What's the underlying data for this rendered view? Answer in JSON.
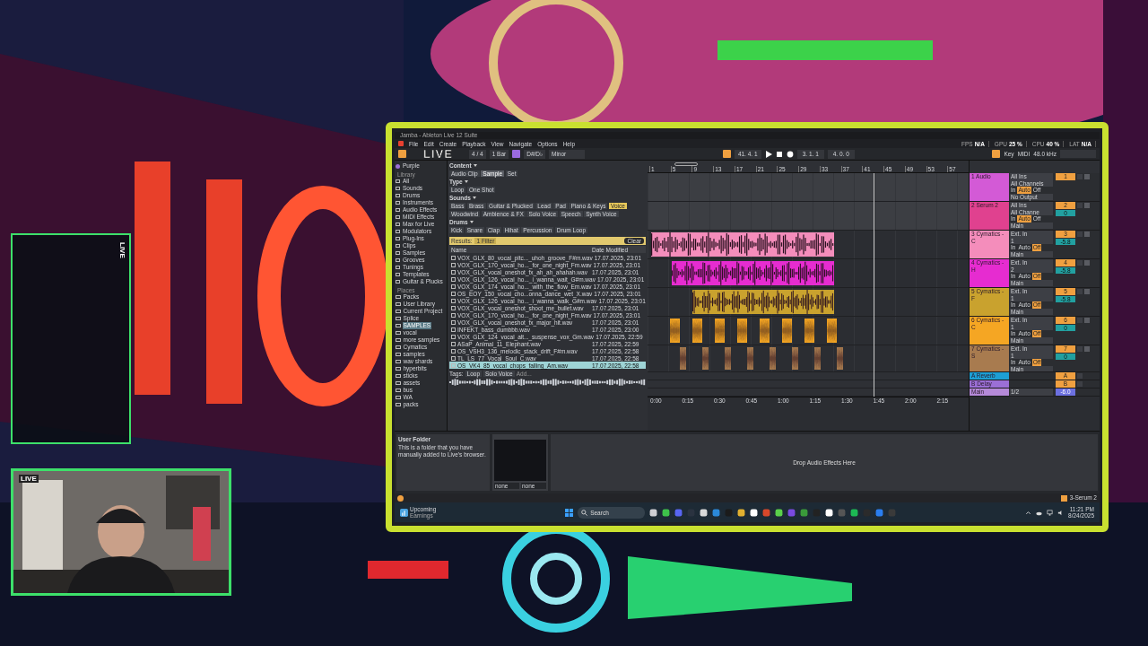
{
  "overlay": {
    "live_badge": "LIVE",
    "side_panel_label": "LIVE",
    "camera_label": "LIVE"
  },
  "daw": {
    "title": "Jamba - Ableton Live 12 Suite",
    "menu": [
      "File",
      "Edit",
      "Create",
      "Playback",
      "View",
      "Navigate",
      "Options",
      "Help"
    ],
    "perf": [
      {
        "label": "FPS",
        "value": "N/A"
      },
      {
        "label": "GPU",
        "value": "25 %"
      },
      {
        "label": "CPU",
        "value": "40 %"
      },
      {
        "label": "LAT",
        "value": "N/A"
      }
    ],
    "control_bar": {
      "meter": "4 / 4",
      "quantize": "1 Bar",
      "scale_root": "D#/D♭",
      "scale": "Minor",
      "position": "41. 4. 1",
      "loop_start": "3. 1. 1",
      "loop_length": "4. 0. 0",
      "key_label": "Key",
      "midi_label": "MIDI",
      "sample_rate": "48.0 kHz"
    },
    "browser": {
      "collections": [
        {
          "label": "Purple",
          "color": "#9b6fd6"
        }
      ],
      "library_heading": "Library",
      "library": [
        "All",
        "Sounds",
        "Drums",
        "Instruments",
        "Audio Effects",
        "MIDI Effects",
        "Max for Live",
        "Modulators",
        "Plug-Ins",
        "Clips",
        "Samples",
        "Grooves",
        "Tunings",
        "Templates",
        "Guitar & Plucks"
      ],
      "places_heading": "Places",
      "places": [
        {
          "label": "Packs",
          "selected": false
        },
        {
          "label": "User Library",
          "selected": false
        },
        {
          "label": "Current Project",
          "selected": false
        },
        {
          "label": "Splice",
          "selected": false
        },
        {
          "label": "SAMPLES",
          "selected": true
        },
        {
          "label": "vocal",
          "selected": false
        },
        {
          "label": "more samples",
          "selected": false
        },
        {
          "label": "Cymatics",
          "selected": false
        },
        {
          "label": "samples",
          "selected": false
        },
        {
          "label": "wav shards",
          "selected": false
        },
        {
          "label": "hyperbits",
          "selected": false
        },
        {
          "label": "sticks",
          "selected": false
        },
        {
          "label": "assets",
          "selected": false
        },
        {
          "label": "bus",
          "selected": false
        },
        {
          "label": "WA",
          "selected": false
        },
        {
          "label": "packs",
          "selected": false
        }
      ],
      "filters": [
        {
          "heading": "Content",
          "chips": [
            {
              "label": "Audio Clip",
              "selected": false
            },
            {
              "label": "Sample",
              "selected": true
            },
            {
              "label": "Set",
              "selected": false
            }
          ]
        },
        {
          "heading": "Type",
          "chips": [
            {
              "label": "Loop",
              "selected": false
            },
            {
              "label": "One Shot",
              "selected": false
            }
          ]
        },
        {
          "heading": "Sounds",
          "chips": [
            {
              "label": "Bass",
              "selected": false
            },
            {
              "label": "Brass",
              "selected": false
            },
            {
              "label": "Guitar & Plucked",
              "selected": false
            },
            {
              "label": "Lead",
              "selected": false
            },
            {
              "label": "Pad",
              "selected": false
            },
            {
              "label": "Piano & Keys",
              "selected": false
            },
            {
              "label": "Voice",
              "selected": true
            },
            {
              "label": "Woodwind",
              "selected": false
            },
            {
              "label": "Ambience & FX",
              "selected": false
            },
            {
              "label": "Solo Voice",
              "selected": false
            },
            {
              "label": "Speech",
              "selected": false
            },
            {
              "label": "Synth Voice",
              "selected": false
            }
          ]
        },
        {
          "heading": "Drums",
          "chips": [
            {
              "label": "Kick",
              "selected": false
            },
            {
              "label": "Snare",
              "selected": false
            },
            {
              "label": "Clap",
              "selected": false
            },
            {
              "label": "Hihat",
              "selected": false
            },
            {
              "label": "Percussion",
              "selected": false
            },
            {
              "label": "Drum Loop",
              "selected": false
            }
          ]
        }
      ],
      "results_label": "Results:",
      "filter_count": "1 Filter",
      "clear": "Clear",
      "columns": [
        "Name",
        "Date Modified"
      ],
      "files": [
        {
          "name": "VOX_GLX_80_vocal_pitc..._uhoh_groove_F#m.wav",
          "date": "17.07.2025, 23:01",
          "selected": false
        },
        {
          "name": "VOX_GLX_170_vocal_ho..._for_one_night_Fm.wav",
          "date": "17.07.2025, 23:01",
          "selected": false
        },
        {
          "name": "VOX_GLX_vocal_oneshot_fx_ah_ah_ahahah.wav",
          "date": "17.07.2025, 23:01",
          "selected": false
        },
        {
          "name": "VOX_GLX_126_vocal_ho..._i_wanna_wait_G#m.wav",
          "date": "17.07.2025, 23:01",
          "selected": false
        },
        {
          "name": "VOX_GLX_174_vocal_ho..._with_the_flow_Em.wav",
          "date": "17.07.2025, 23:01",
          "selected": false
        },
        {
          "name": "OS_EOY_150_vocal_cho...onna_dance_wet_X.wav",
          "date": "17.07.2025, 23:01",
          "selected": false
        },
        {
          "name": "VOX_GLX_126_vocal_ho..._i_wanna_walk_G#m.wav",
          "date": "17.07.2025, 23:01",
          "selected": false
        },
        {
          "name": "VOX_GLX_vocal_oneshot_shoot_me_bullet.wav",
          "date": "17.07.2025, 23:01",
          "selected": false
        },
        {
          "name": "VOX_GLX_170_vocal_ho..._for_one_night_Fm.wav",
          "date": "17.07.2025, 23:01",
          "selected": false
        },
        {
          "name": "VOX_GLX_vocal_oneshot_fx_major_hit.wav",
          "date": "17.07.2025, 23:01",
          "selected": false
        },
        {
          "name": "INFEKT_bass_dumbbb.wav",
          "date": "17.07.2025, 23:00",
          "selected": false
        },
        {
          "name": "VOX_GLX_124_vocal_alt..._suspense_vox_Gm.wav",
          "date": "17.07.2025, 22:59",
          "selected": false
        },
        {
          "name": "ASaP_Animal_11_Elephant.wav",
          "date": "17.07.2025, 22:59",
          "selected": false
        },
        {
          "name": "OS_VSH3_136_melodic_stack_drift_F#m.wav",
          "date": "17.07.2025, 22:58",
          "selected": false
        },
        {
          "name": "TL_LS_77_Vocal_Soul_C.wav",
          "date": "17.07.2025, 22:58",
          "selected": false
        },
        {
          "name": "OS_VK4_85_vocal_chops_falling_Am.wav",
          "date": "17.07.2025, 22:58",
          "selected": true
        }
      ],
      "tags_label": "Tags:",
      "tags": [
        "Loop",
        "Solo Voice"
      ],
      "add_tag": "Add..."
    },
    "ruler": [
      "1",
      "5",
      "9",
      "13",
      "17",
      "21",
      "25",
      "29",
      "33",
      "37",
      "41",
      "45",
      "49",
      "53",
      "57"
    ],
    "time_ruler": [
      "0:00",
      "0:15",
      "0:30",
      "0:45",
      "1:00",
      "1:15",
      "1:30",
      "1:45",
      "2:00",
      "2:15"
    ],
    "tracks": [
      {
        "kind": "audio",
        "name": "1 Audio",
        "color": "#d35ad6",
        "input": "All Ins",
        "channel": "All Channels",
        "output": "No Output",
        "number": "1",
        "monitor": [
          {
            "label": "In",
            "selected": false
          },
          {
            "label": "Auto",
            "selected": true
          },
          {
            "label": "Off",
            "selected": false
          }
        ]
      },
      {
        "kind": "midi",
        "name": "2 Serum 2",
        "color": "#e0418f",
        "input": "All Ins",
        "channel": "All Channe",
        "output": "Main",
        "number": "2",
        "volume": "0",
        "monitor": [
          {
            "label": "In",
            "selected": false
          },
          {
            "label": "Auto",
            "selected": true
          },
          {
            "label": "Off",
            "selected": false
          }
        ]
      },
      {
        "kind": "audio",
        "name": "3 Cymatics - C",
        "color": "#f48dbb",
        "input": "Ext. In",
        "channel": "1",
        "output": "Main",
        "number": "3",
        "volume": "-5.8",
        "monitor": [
          {
            "label": "In",
            "selected": false
          },
          {
            "label": "Auto",
            "selected": false
          },
          {
            "label": "Off",
            "selected": true
          }
        ]
      },
      {
        "kind": "audio",
        "name": "4 Cymatics - H",
        "color": "#e62cd0",
        "input": "Ext. In",
        "channel": "2",
        "output": "Main",
        "number": "4",
        "volume": "-5.8",
        "monitor": [
          {
            "label": "In",
            "selected": false
          },
          {
            "label": "Auto",
            "selected": false
          },
          {
            "label": "Off",
            "selected": true
          }
        ]
      },
      {
        "kind": "audio",
        "name": "5 Cymatics - F",
        "color": "#c9a22e",
        "input": "Ext. In",
        "channel": "1",
        "output": "Main",
        "number": "5",
        "volume": "-5.8",
        "monitor": [
          {
            "label": "In",
            "selected": false
          },
          {
            "label": "Auto",
            "selected": false
          },
          {
            "label": "Off",
            "selected": true
          }
        ]
      },
      {
        "kind": "audio",
        "name": "6 Cymatics - C",
        "color": "#f5a623",
        "input": "Ext. In",
        "channel": "1",
        "output": "Main",
        "number": "6",
        "volume": "0",
        "monitor": [
          {
            "label": "In",
            "selected": false
          },
          {
            "label": "Auto",
            "selected": false
          },
          {
            "label": "Off",
            "selected": true
          }
        ]
      },
      {
        "kind": "audio",
        "name": "7 Cymatics - S",
        "color": "#a87b4f",
        "input": "Ext. In",
        "channel": "1",
        "output": "Main",
        "number": "7",
        "volume": "0",
        "monitor": [
          {
            "label": "In",
            "selected": false
          },
          {
            "label": "Auto",
            "selected": false
          },
          {
            "label": "Off",
            "selected": true
          }
        ]
      },
      {
        "kind": "return",
        "name": "A Reverb",
        "color": "#1d9fd4",
        "number": "A"
      },
      {
        "kind": "return",
        "name": "B Delay",
        "color": "#9b6fd6",
        "number": "B"
      },
      {
        "kind": "main",
        "name": "Main",
        "color": "#b68ad9",
        "input": "1/2",
        "volume": "-6.0"
      }
    ],
    "detail": {
      "info_title": "User Folder",
      "info_text": "This is a folder that you have manually added to Live's browser.",
      "device_selectors": [
        "none",
        "none"
      ],
      "drop_hint": "Drop Audio Effects Here"
    },
    "status": {
      "track_name": "3-Serum 2"
    }
  },
  "taskbar": {
    "widget_title": "Upcoming",
    "widget_subtitle": "Earnings",
    "search_placeholder": "Search",
    "time": "11:21 PM",
    "date": "8/24/2025"
  }
}
